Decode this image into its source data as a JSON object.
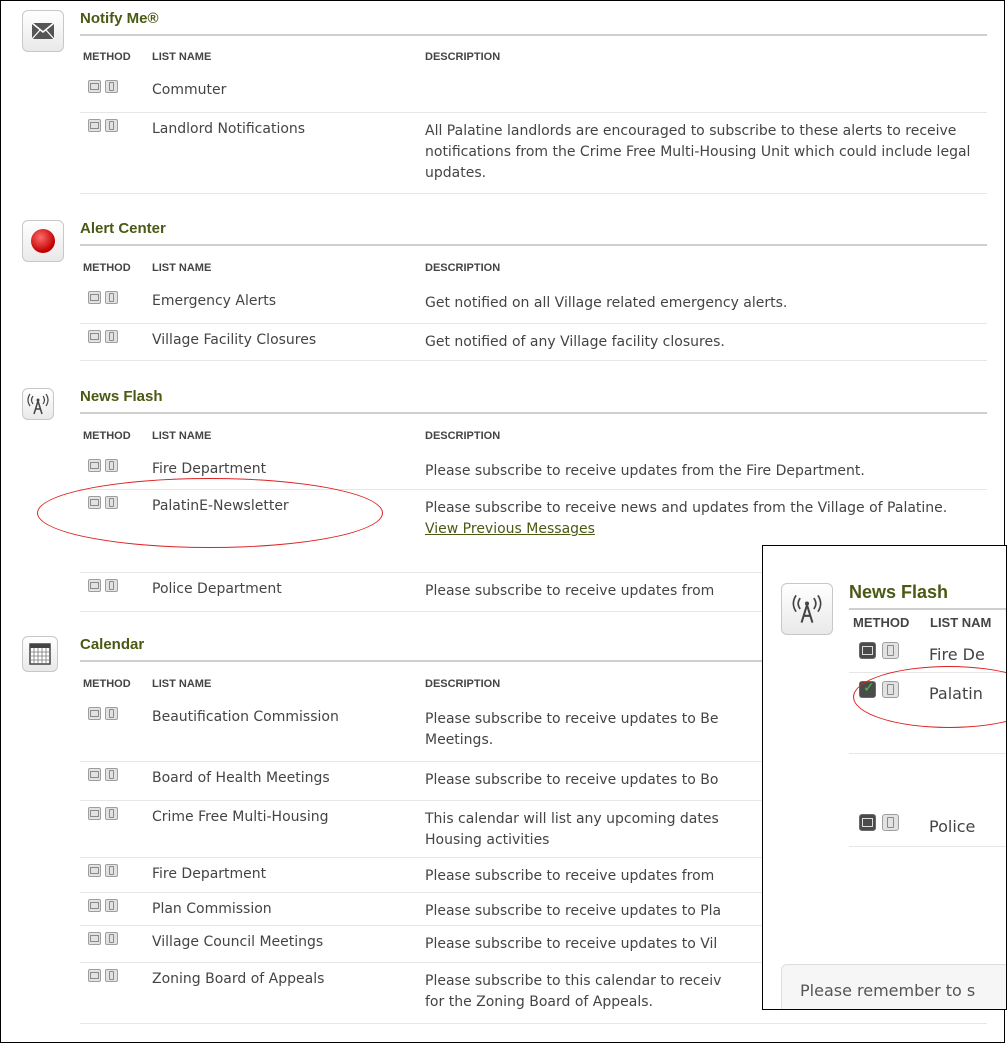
{
  "headers": {
    "method": "METHOD",
    "list_name": "LIST NAME",
    "description": "DESCRIPTION"
  },
  "sections": [
    {
      "title": "Notify Me®",
      "icon": "envelope-icon",
      "rows": [
        {
          "name": "Commuter",
          "description": ""
        },
        {
          "name": "Landlord Notifications",
          "description": "All Palatine landlords are encouraged to subscribe to these alerts to receive notifications from the Crime Free Multi-Housing Unit which could include legal updates."
        }
      ]
    },
    {
      "title": "Alert Center",
      "icon": "red-alert-icon",
      "rows": [
        {
          "name": "Emergency Alerts",
          "description": "Get notified on all Village related emergency alerts."
        },
        {
          "name": "Village Facility Closures",
          "description": "Get notified of any Village facility closures."
        }
      ]
    },
    {
      "title": "News Flash",
      "icon": "broadcast-tower-icon",
      "rows": [
        {
          "name": "Fire Department",
          "description": "Please subscribe to receive updates from the Fire Department."
        },
        {
          "name": "PalatinE-Newsletter",
          "description": "Please subscribe to receive news and updates from the Village of Palatine.",
          "link": "View Previous Messages"
        },
        {
          "name": "Police Department",
          "description": "Please subscribe to receive updates from"
        }
      ]
    },
    {
      "title": "Calendar",
      "icon": "calendar-icon",
      "rows": [
        {
          "name": "Beautification Commission",
          "description": "Please subscribe to receive updates to Be Meetings."
        },
        {
          "name": "Board of Health Meetings",
          "description": "Please subscribe to receive updates to Bo"
        },
        {
          "name": "Crime Free Multi-Housing",
          "description": "This calendar will list any upcoming dates Housing activities"
        },
        {
          "name": "Fire Department",
          "description": "Please subscribe to receive updates from"
        },
        {
          "name": "Plan Commission",
          "description": "Please subscribe to receive updates to Pla"
        },
        {
          "name": "Village Council Meetings",
          "description": "Please subscribe to receive updates to Vil"
        },
        {
          "name": "Zoning Board of Appeals",
          "description": "Please subscribe to this calendar to receiv for the Zoning Board of Appeals."
        }
      ]
    }
  ],
  "popup": {
    "title": "News Flash",
    "headers": {
      "method": "METHOD",
      "list_name": "LIST NAM"
    },
    "rows": [
      {
        "name": "Fire De",
        "email_checked": false
      },
      {
        "name": "Palatin",
        "email_checked": true
      },
      {
        "name": "Police",
        "email_checked": false
      }
    ],
    "notice": "Please remember to s"
  },
  "colors": {
    "section_title": "#4a5a14",
    "highlight_oval": "#dd2222",
    "check": "#3fc43f"
  }
}
